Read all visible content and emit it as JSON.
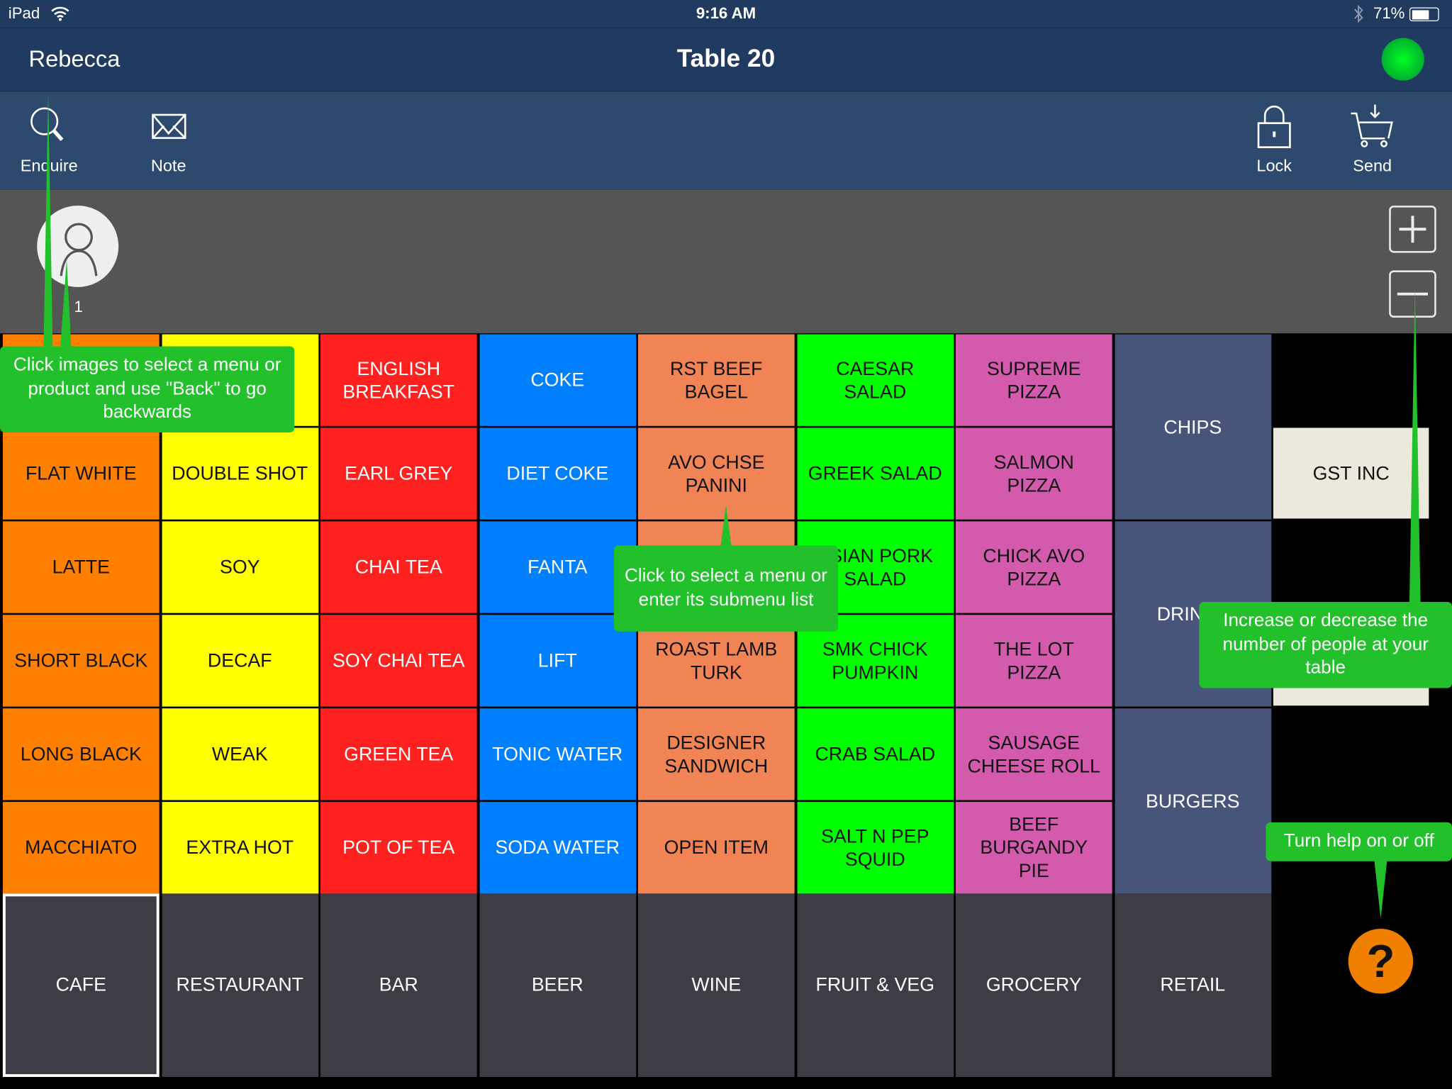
{
  "status_bar": {
    "device": "iPad",
    "time": "9:16 AM",
    "battery": "71%",
    "icons": [
      "wifi-icon",
      "bluetooth-icon",
      "battery-icon"
    ]
  },
  "header": {
    "user": "Rebecca",
    "title": "Table 20",
    "connection_color": "#00e020"
  },
  "toolbar": {
    "enquire": "Enquire",
    "note": "Note",
    "lock": "Lock",
    "send": "Send"
  },
  "seats": {
    "seat_number": "1"
  },
  "colors": {
    "cafe": "#ff8000",
    "extras": "#ffff00",
    "tea": "#ff2020",
    "soft": "#0080ff",
    "food": "#f08455",
    "salad": "#00ff00",
    "pizza": "#d45aae",
    "submenu": "#47557a",
    "menu": "#403c46",
    "gst": "#ebe9dc",
    "help": "#f08000",
    "tooltip": "#22c02a"
  },
  "columns": [
    {
      "color": "#ff8000",
      "items": [
        "",
        "FLAT WHITE",
        "LATTE",
        "SHORT BLACK",
        "LONG BLACK",
        "MACCHIATO"
      ]
    },
    {
      "color": "#ffff00",
      "items": [
        "",
        "DOUBLE SHOT",
        "SOY",
        "DECAF",
        "WEAK",
        "EXTRA HOT"
      ]
    },
    {
      "color": "#ff2020",
      "light": true,
      "items": [
        "ENGLISH\nBREAKFAST",
        "EARL GREY",
        "CHAI TEA",
        "SOY CHAI TEA",
        "GREEN TEA",
        "POT OF TEA"
      ]
    },
    {
      "color": "#0080ff",
      "light": true,
      "items": [
        "COKE",
        "DIET COKE",
        "FANTA",
        "LIFT",
        "TONIC WATER",
        "SODA WATER"
      ]
    },
    {
      "color": "#f08455",
      "items": [
        "RST BEEF\nBAGEL",
        "AVO CHSE\nPANINI",
        "",
        "ROAST LAMB\nTURK",
        "DESIGNER\nSANDWICH",
        "OPEN ITEM"
      ]
    },
    {
      "color": "#00ff00",
      "items": [
        "CAESAR\nSALAD",
        "GREEK SALAD",
        "ASIAN PORK\nSALAD",
        "SMK CHICK\nPUMPKIN",
        "CRAB SALAD",
        "SALT N PEP\nSQUID"
      ]
    },
    {
      "color": "#d45aae",
      "items": [
        "SUPREME\nPIZZA",
        "SALMON\nPIZZA",
        "CHICK AVO\nPIZZA",
        "THE LOT\nPIZZA",
        "SAUSAGE\nCHEESE ROLL",
        "BEEF\nBURGANDY\nPIE"
      ]
    }
  ],
  "submenus": [
    "CHIPS",
    "DRINKS",
    "BURGERS"
  ],
  "gst_button": "GST INC",
  "menus": [
    "CAFE",
    "RESTAURANT",
    "BAR",
    "BEER",
    "WINE",
    "FRUIT & VEG",
    "GROCERY",
    "RETAIL"
  ],
  "selected_menu": "CAFE",
  "help": {
    "label": "?"
  },
  "tooltips": {
    "images": "Click images to select a menu or product and use \"Back\" to go backwards",
    "menu": "Click to select a menu or enter its submenu list",
    "people": "Increase or decrease the number of people at your table",
    "help": "Turn help on or off"
  }
}
